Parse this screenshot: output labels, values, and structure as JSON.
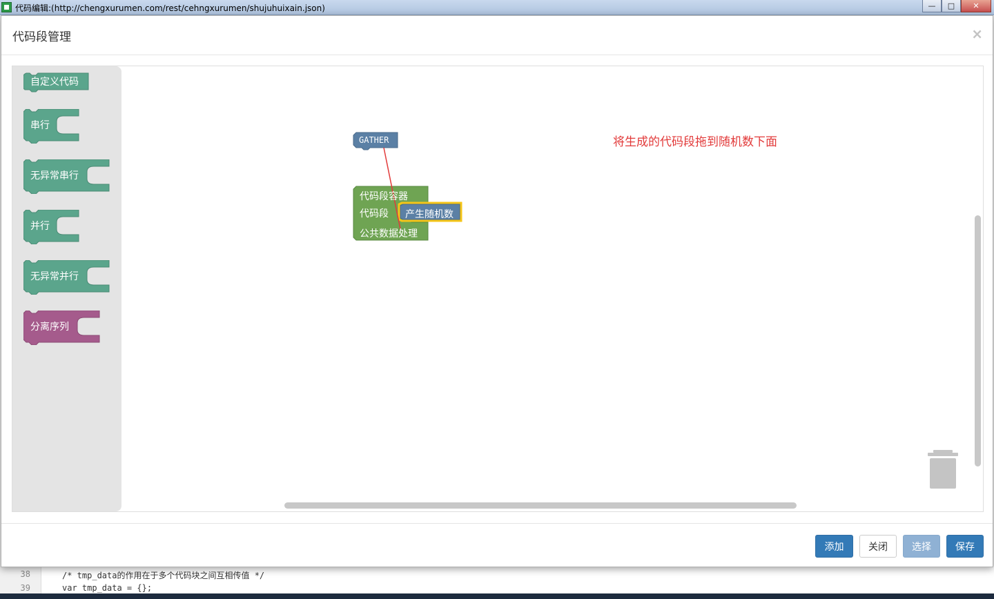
{
  "window": {
    "title": "代码编辑:(http://chengxurumen.com/rest/cehngxurumen/shujuhuixain.json)",
    "minimize": "—",
    "maximize": "□",
    "close": "✕"
  },
  "modal": {
    "title": "代码段管理",
    "close": "×"
  },
  "toolbox": {
    "items": [
      {
        "label": "自定义代码",
        "color": "#5ba58c"
      },
      {
        "label": "串行",
        "color": "#5ba58c"
      },
      {
        "label": "无异常串行",
        "color": "#5ba58c"
      },
      {
        "label": "并行",
        "color": "#5ba58c"
      },
      {
        "label": "无异常并行",
        "color": "#5ba58c"
      },
      {
        "label": "分离序列",
        "color": "#a55b8c"
      }
    ]
  },
  "canvas": {
    "hint": "将生成的代码段拖到随机数下面",
    "gather_block": "GATHER",
    "container_block": {
      "title": "代码段容器",
      "row1": "代码段",
      "row2": "公共数据处理",
      "color": "#6fa453"
    },
    "random_block": "产生随机数",
    "random_color": "#5b80a5",
    "highlight_color": "#f5c518"
  },
  "footer": {
    "add": "添加",
    "close": "关闭",
    "select": "选择",
    "save": "保存"
  },
  "background_editor": {
    "lines": [
      {
        "num": "38",
        "text": "/* tmp_data的作用在于多个代码块之间互相传值 */"
      },
      {
        "num": "39",
        "text": "var tmp_data = {};"
      }
    ]
  }
}
